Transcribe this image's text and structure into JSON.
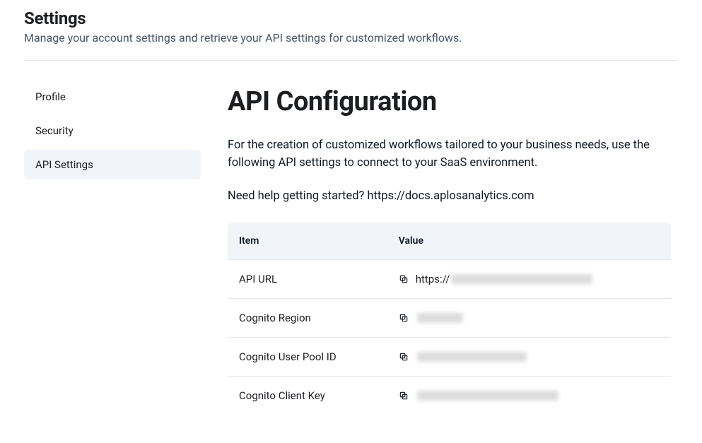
{
  "header": {
    "title": "Settings",
    "subtitle": "Manage your account settings and retrieve your API settings for customized workflows."
  },
  "sidebar": {
    "items": [
      {
        "label": "Profile",
        "active": false
      },
      {
        "label": "Security",
        "active": false
      },
      {
        "label": "API Settings",
        "active": true
      }
    ]
  },
  "main": {
    "title": "API Configuration",
    "description": "For the creation of customized workflows tailored to your business needs, use the following API settings to connect to your SaaS environment.",
    "help_prefix": "Need help getting started? ",
    "help_link": "https://docs.aplosanalytics.com",
    "table": {
      "columns": {
        "item": "Item",
        "value": "Value"
      },
      "rows": [
        {
          "item": "API URL",
          "value_prefix": "https://",
          "value_redacted": true,
          "redact_width": 200
        },
        {
          "item": "Cognito Region",
          "value_prefix": "",
          "value_redacted": true,
          "redact_width": 65
        },
        {
          "item": "Cognito User Pool ID",
          "value_prefix": "",
          "value_redacted": true,
          "redact_width": 155
        },
        {
          "item": "Cognito Client Key",
          "value_prefix": "",
          "value_redacted": true,
          "redact_width": 200
        }
      ]
    }
  }
}
